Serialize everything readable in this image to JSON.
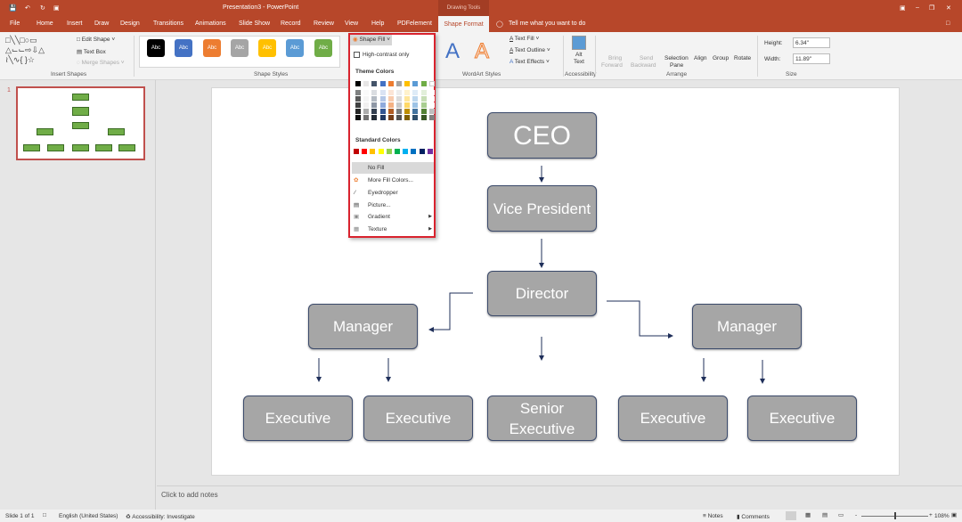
{
  "titlebar": {
    "title": "Presentation3 - PowerPoint",
    "context_tab_group": "Drawing Tools"
  },
  "tabs": [
    "File",
    "Home",
    "Insert",
    "Draw",
    "Design",
    "Transitions",
    "Animations",
    "Slide Show",
    "Record",
    "Review",
    "View",
    "Help",
    "PDFelement",
    "Shape Format"
  ],
  "active_tab": "Shape Format",
  "tell_me": "Tell me what you want to do",
  "ribbon": {
    "insert_shapes": {
      "label": "Insert Shapes",
      "edit_shape": "Edit Shape",
      "text_box": "Text Box",
      "merge_shapes": "Merge Shapes"
    },
    "shape_styles": {
      "label": "Shape Styles",
      "swatch_text": "Abc",
      "swatch_colors": [
        "#000000",
        "#4472c4",
        "#ed7d31",
        "#a5a5a5",
        "#ffc000",
        "#5b9bd5",
        "#70ad47"
      ],
      "shape_fill": "Shape Fill"
    },
    "wordart": {
      "label": "WordArt Styles",
      "text_fill": "Text Fill",
      "text_outline": "Text Outline",
      "text_effects": "Text Effects",
      "letter": "A"
    },
    "accessibility": {
      "label": "Accessibility",
      "alt_text_1": "Alt",
      "alt_text_2": "Text"
    },
    "arrange": {
      "label": "Arrange",
      "bring_forward_1": "Bring",
      "bring_forward_2": "Forward",
      "send_backward_1": "Send",
      "send_backward_2": "Backward",
      "selection_pane_1": "Selection",
      "selection_pane_2": "Pane",
      "align": "Align",
      "group": "Group",
      "rotate": "Rotate"
    },
    "size": {
      "label": "Size",
      "height_label": "Height:",
      "height_value": "6.34\"",
      "width_label": "Width:",
      "width_value": "11.89\""
    }
  },
  "shape_fill_menu": {
    "high_contrast": "High-contrast only",
    "theme_colors_label": "Theme Colors",
    "theme_colors": [
      "#000000",
      "#e7e6e6",
      "#44546a",
      "#4472c4",
      "#ed7d31",
      "#a5a5a5",
      "#ffc000",
      "#5b9bd5",
      "#70ad47",
      "#ffffff"
    ],
    "standard_colors_label": "Standard Colors",
    "standard_colors": [
      "#c00000",
      "#ff0000",
      "#ffc000",
      "#ffff00",
      "#92d050",
      "#00b050",
      "#00b0f0",
      "#0070c0",
      "#002060",
      "#7030a0"
    ],
    "items": [
      {
        "label": "No Fill",
        "icon": "none"
      },
      {
        "label": "More Fill Colors...",
        "icon": "palette-icon"
      },
      {
        "label": "Eyedropper",
        "icon": "eyedropper-icon"
      },
      {
        "label": "Picture...",
        "icon": "picture-icon"
      },
      {
        "label": "Gradient",
        "icon": "gradient-icon",
        "submenu": true
      },
      {
        "label": "Texture",
        "icon": "texture-icon",
        "submenu": true
      }
    ]
  },
  "thumbnail": {
    "number": "1"
  },
  "slide": {
    "ceo": "CEO",
    "vp": "Vice President",
    "director": "Director",
    "manager_left": "Manager",
    "manager_right": "Manager",
    "executives": [
      "Executive",
      "Executive",
      "Senior Executive",
      "Executive",
      "Executive"
    ]
  },
  "notes_placeholder": "Click to add notes",
  "status": {
    "slide": "Slide 1 of 1",
    "language": "English (United States)",
    "accessibility": "Accessibility: Investigate",
    "notes": "Notes",
    "comments": "Comments",
    "zoom": "108%"
  }
}
